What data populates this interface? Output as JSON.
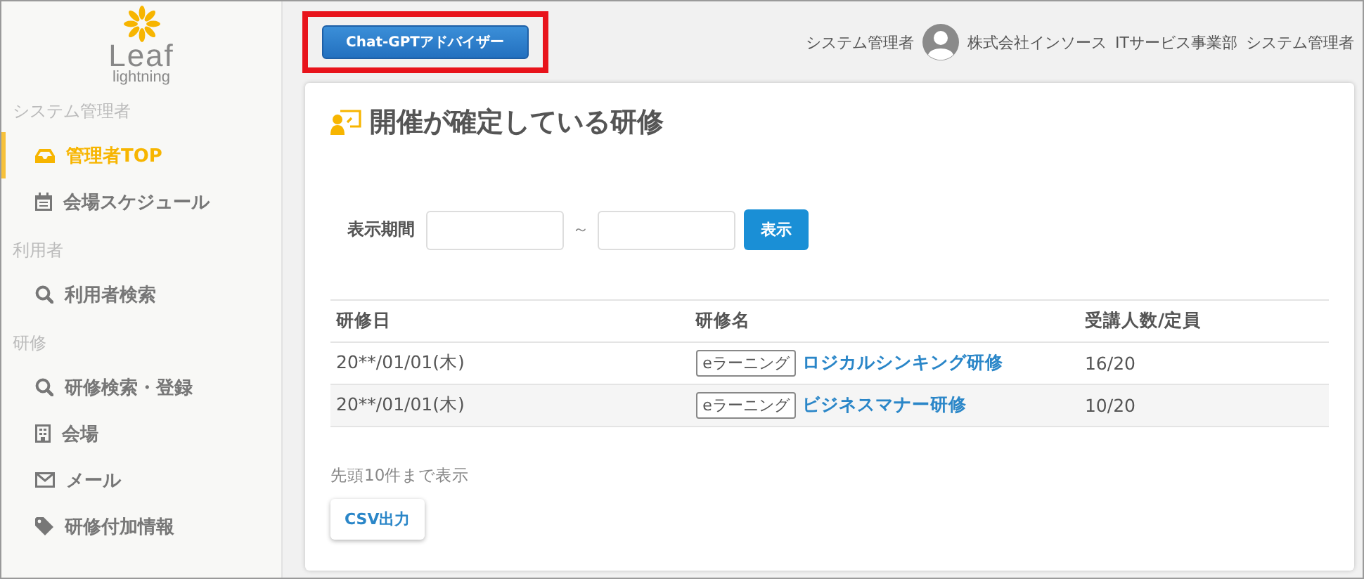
{
  "logo": {
    "name": "Leaf",
    "sub": "lightning"
  },
  "sidebar": {
    "sections": [
      {
        "label": "システム管理者",
        "items": [
          {
            "label": "管理者TOP",
            "selected": true
          },
          {
            "label": "会場スケジュール",
            "selected": false
          }
        ]
      },
      {
        "label": "利用者",
        "items": [
          {
            "label": "利用者検索",
            "selected": false
          }
        ]
      },
      {
        "label": "研修",
        "items": [
          {
            "label": "研修検索・登録",
            "selected": false
          },
          {
            "label": "会場",
            "selected": false
          },
          {
            "label": "メール",
            "selected": false
          },
          {
            "label": "研修付加情報",
            "selected": false
          }
        ]
      }
    ]
  },
  "header": {
    "advisor_button": "Chat-GPTアドバイザー",
    "role": "システム管理者",
    "company": "株式会社インソース",
    "department": "ITサービス事業部",
    "user": "システム管理者"
  },
  "card": {
    "title": "開催が確定している研修",
    "filter": {
      "label": "表示期間",
      "separator": "～",
      "button": "表示"
    },
    "table": {
      "columns": [
        "研修日",
        "研修名",
        "受講人数/定員"
      ],
      "rows": [
        {
          "date": "20**/01/01(木)",
          "tag": "eラーニング",
          "name": "ロジカルシンキング研修",
          "count": "16/20"
        },
        {
          "date": "20**/01/01(木)",
          "tag": "eラーニング",
          "name": "ビジネスマナー研修",
          "count": "10/20"
        }
      ]
    },
    "note": "先頭10件まで表示",
    "csv_button": "CSV出力"
  }
}
